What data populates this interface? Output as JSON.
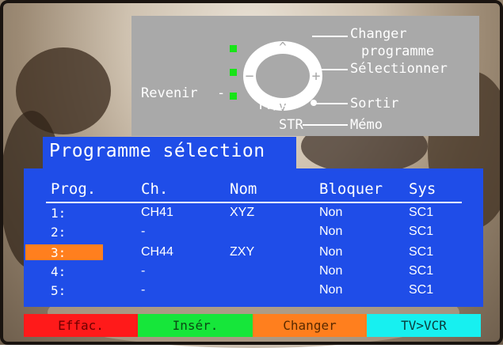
{
  "help": {
    "changer_1": "Changer",
    "changer_2": "programme",
    "selectionner": "Sélectionner",
    "revenir": "Revenir",
    "tvav": "TV/AV",
    "sortir": "Sortir",
    "str": "STR",
    "memo": "Mémo",
    "colors": {
      "panel": "#a9a9a9",
      "indicator": "#18e418"
    }
  },
  "title": "Programme sélection",
  "table": {
    "headers": [
      "Prog.",
      "Ch.",
      "Nom",
      "Bloquer",
      "Sys"
    ],
    "rows": [
      {
        "prog": "1:",
        "ch": "CH41",
        "nom": "XYZ",
        "bloquer": "Non",
        "sys": "SC1"
      },
      {
        "prog": "2:",
        "ch": "-",
        "nom": "",
        "bloquer": "Non",
        "sys": "SC1"
      },
      {
        "prog": "3:",
        "ch": "CH44",
        "nom": "ZXY",
        "bloquer": "Non",
        "sys": "SC1"
      },
      {
        "prog": "4:",
        "ch": "-",
        "nom": "",
        "bloquer": "Non",
        "sys": "SC1"
      },
      {
        "prog": "5:",
        "ch": "-",
        "nom": "",
        "bloquer": "Non",
        "sys": "SC1"
      }
    ],
    "selected_row": 3,
    "colors": {
      "panel": "#1f4de8",
      "selection": "#ff7f1e"
    }
  },
  "buttons": [
    {
      "label": "Effac.",
      "color": "#ff1a1a"
    },
    {
      "label": "Insér.",
      "color": "#16e63a"
    },
    {
      "label": "Changer",
      "color": "#ff7f1e"
    },
    {
      "label": "TV>VCR",
      "color": "#17f0f0"
    }
  ]
}
